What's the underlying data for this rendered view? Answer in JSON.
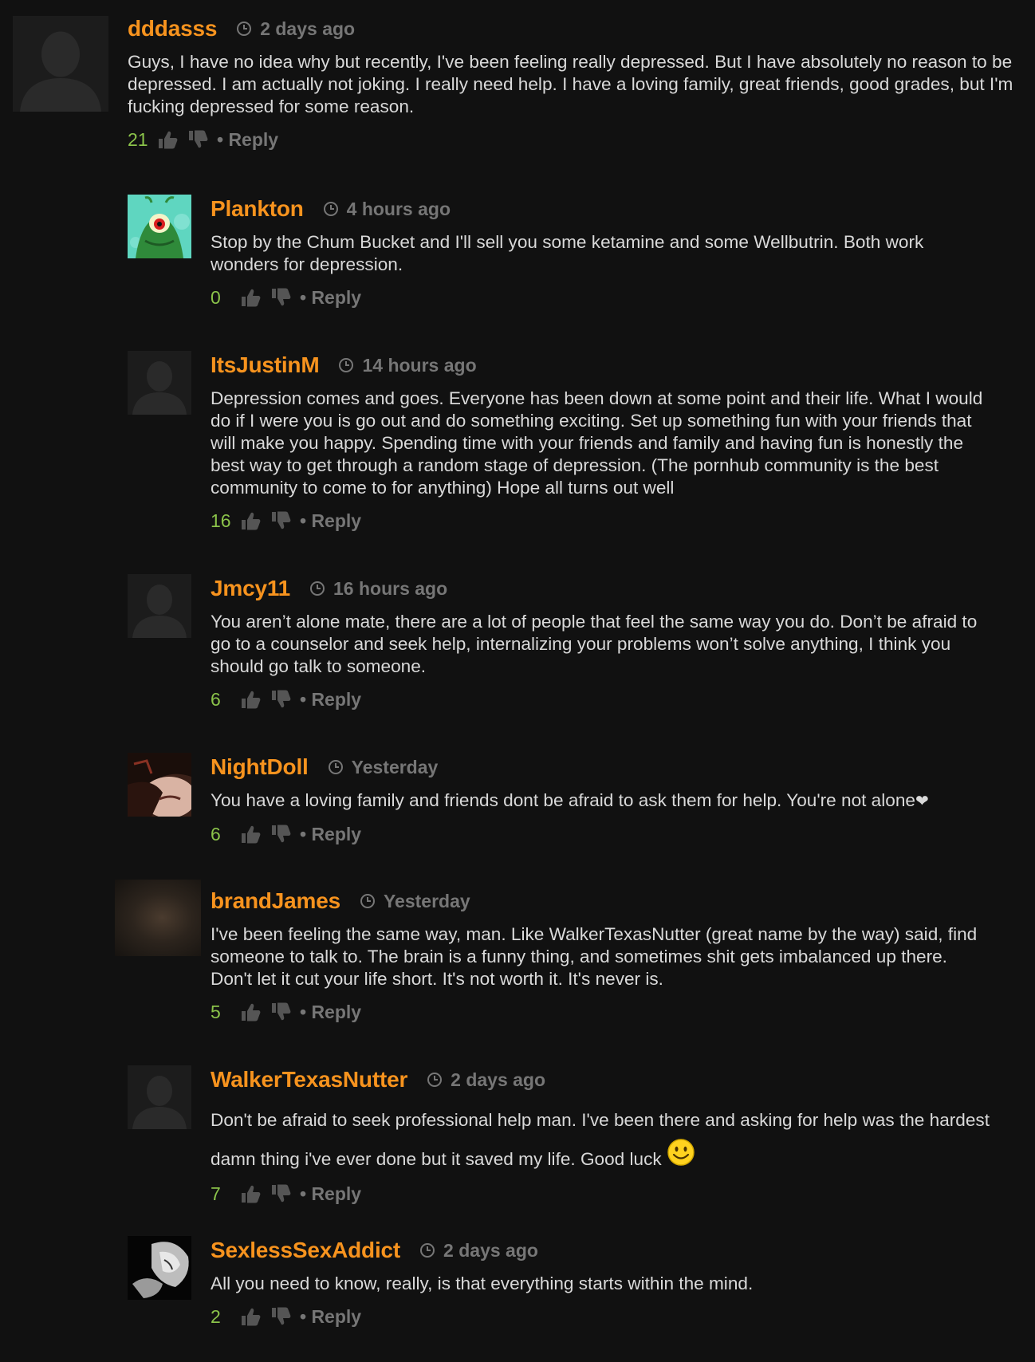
{
  "comments": [
    {
      "username": "dddasss",
      "time": "2 days ago",
      "text": "Guys, I have no idea why but recently, I've been feeling really depressed. But I have absolutely no reason to be depressed. I am actually not joking. I really need help. I have a loving family, great friends, good grades, but I'm fucking depressed for some reason.",
      "votes": "21",
      "reply_label": "• Reply",
      "avatar": "default-silhouette"
    },
    {
      "username": "Plankton",
      "time": "4 hours ago",
      "text": "Stop by the Chum Bucket and I'll sell you some ketamine and some Wellbutrin. Both work wonders for depression.",
      "votes": "0",
      "reply_label": "• Reply",
      "avatar": "plankton-picture"
    },
    {
      "username": "ItsJustinM",
      "time": "14 hours ago",
      "text": "Depression comes and goes. Everyone has been down at some point and their life. What I would do if I were you is go out and do something exciting. Set up something fun with your friends that will make you happy. Spending time with your friends and family and having fun is honestly the best way to get through a random stage of depression. (The pornhub community is the best community to come to for anything) Hope all turns out well",
      "votes": "16",
      "reply_label": "• Reply",
      "avatar": "default-silhouette"
    },
    {
      "username": "Jmcy11",
      "time": "16 hours ago",
      "text": "You aren’t alone mate, there are a lot of people that feel the same way you do. Don’t be afraid to go to a counselor and seek help, internalizing your problems won’t solve anything, I think you should go talk to someone.",
      "votes": "6",
      "reply_label": "• Reply",
      "avatar": "default-silhouette"
    },
    {
      "username": "NightDoll",
      "time": "Yesterday",
      "text": "You have a loving family and friends dont be afraid to ask them for help. You're not alone",
      "text_suffix": "❤",
      "votes": "6",
      "reply_label": "• Reply",
      "avatar": "face-photo"
    },
    {
      "username": "brandJames",
      "time": "Yesterday",
      "text": "I've been feeling the same way, man. Like WalkerTexasNutter (great name by the way) said, find someone to talk to. The brain is a funny thing, and sometimes shit gets imbalanced up there. Don't let it cut your life short. It's not worth it. It's never is.",
      "votes": "5",
      "reply_label": "• Reply",
      "avatar": "blurred-photo"
    },
    {
      "username": "WalkerTexasNutter",
      "time": "2 days ago",
      "text": "Don't be afraid to seek professional help man. I've been there and asking for help was the hardest damn thing i've ever done but it saved my life. Good luck",
      "votes": "7",
      "reply_label": "• Reply",
      "avatar": "default-silhouette",
      "emoji": "smiley-icon"
    },
    {
      "username": "SexlessSexAddict",
      "time": "2 days ago",
      "text": "All you need to know, really, is that everything starts within the mind.",
      "votes": "2",
      "reply_label": "• Reply",
      "avatar": "bw-photo"
    }
  ],
  "colors": {
    "background": "#111111",
    "username": "#f7931e",
    "meta": "#767676",
    "text": "#d9d9d9",
    "votes": "#8bc34a"
  }
}
